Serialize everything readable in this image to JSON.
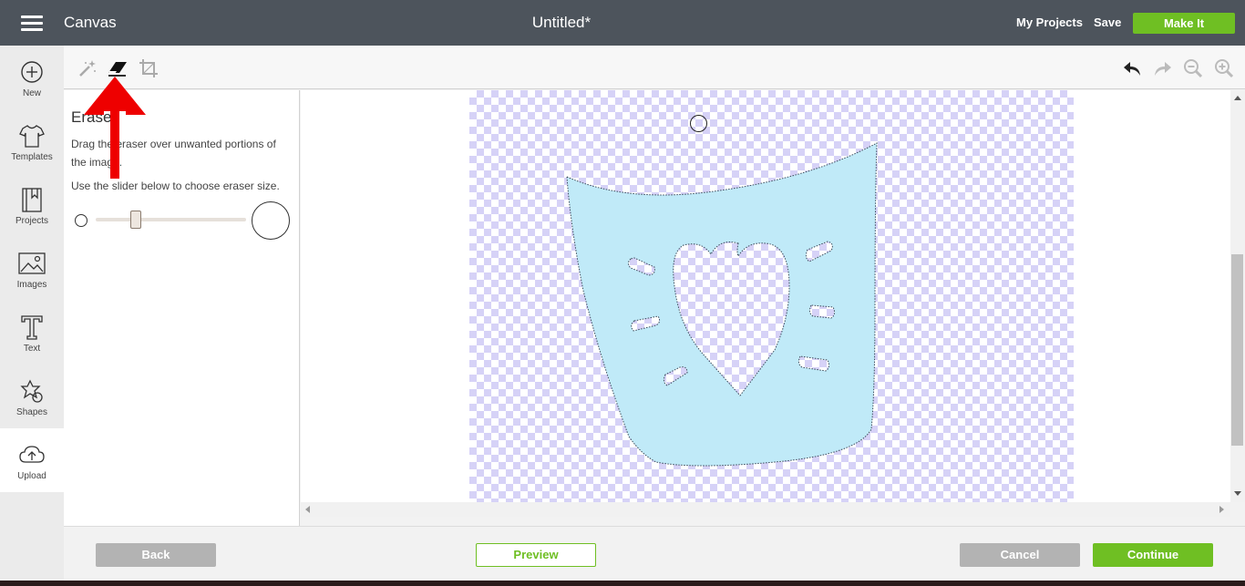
{
  "header": {
    "app_title": "Canvas",
    "doc_title": "Untitled*",
    "my_projects": "My Projects",
    "save": "Save",
    "make_it": "Make It"
  },
  "sidebar": {
    "items": [
      {
        "label": "New",
        "icon": "plus-circle-icon"
      },
      {
        "label": "Templates",
        "icon": "shirt-icon"
      },
      {
        "label": "Projects",
        "icon": "bookmark-book-icon"
      },
      {
        "label": "Images",
        "icon": "image-icon"
      },
      {
        "label": "Text",
        "icon": "text-t-icon"
      },
      {
        "label": "Shapes",
        "icon": "shapes-icon"
      },
      {
        "label": "Upload",
        "icon": "cloud-upload-icon",
        "active": true
      }
    ]
  },
  "toolbar": {
    "left_tools": [
      "magic-wand-icon",
      "eraser-icon",
      "crop-icon"
    ],
    "right_tools": [
      "undo-icon",
      "redo-icon",
      "zoom-out-icon",
      "zoom-in-icon"
    ]
  },
  "panel": {
    "title": "Eraser",
    "instruction_1": "Drag the eraser over unwanted portions of the image.",
    "instruction_2": "Use the slider below to choose eraser size.",
    "slider_value": 0.25
  },
  "footer": {
    "back": "Back",
    "preview": "Preview",
    "cancel": "Cancel",
    "continue": "Continue"
  },
  "colors": {
    "accent": "#6fbf23",
    "header_bg": "#4d545c",
    "artwork_fill": "#c0eaf8",
    "checker": "#d6d2f7",
    "annotation_arrow": "#ee0000"
  }
}
